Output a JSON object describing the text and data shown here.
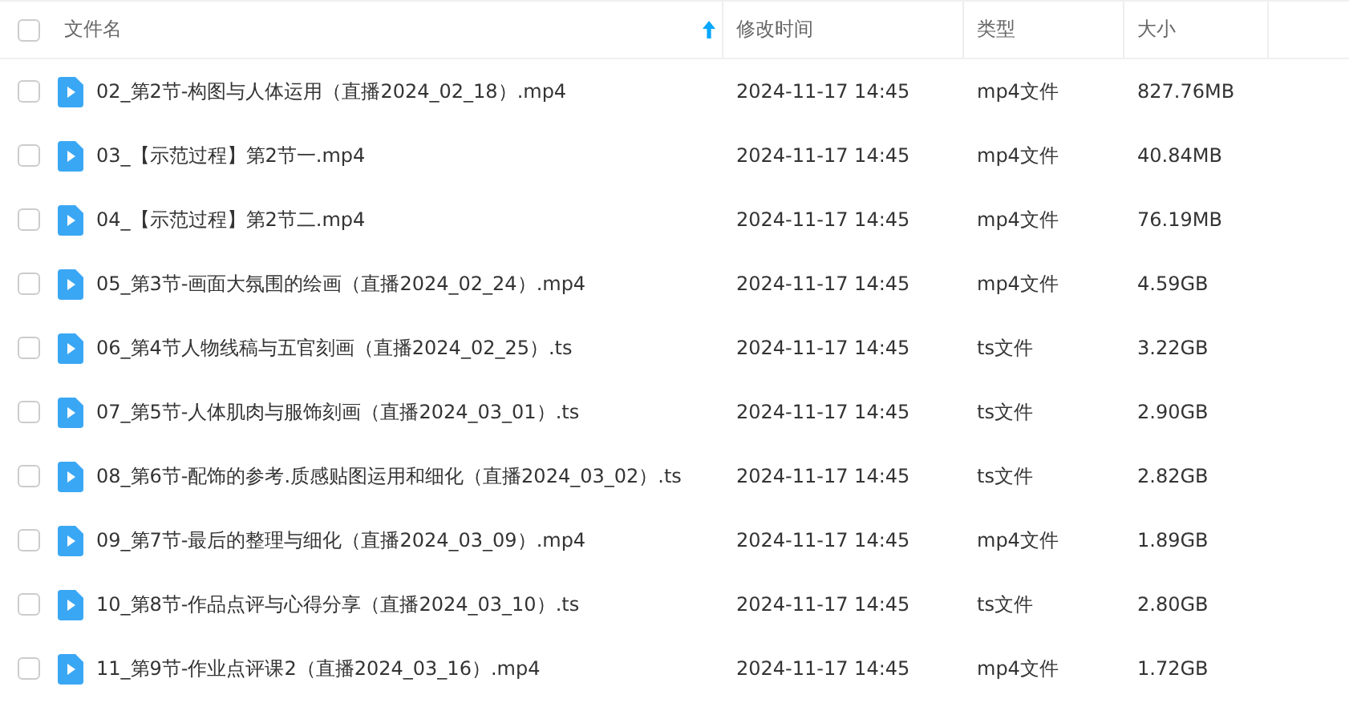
{
  "table": {
    "select_all": {
      "checked": false
    },
    "columns": [
      {
        "label": "文件名",
        "sorted": true
      },
      {
        "label": "修改时间",
        "sorted": false
      },
      {
        "label": "类型",
        "sorted": false
      },
      {
        "label": "大小",
        "sorted": false
      }
    ],
    "rows": [
      {
        "checked": false,
        "name": "02_第2节-构图与人体运用（直播2024_02_18）.mp4",
        "modified": "2024-11-17 14:45",
        "type": "mp4文件",
        "size": "827.76MB"
      },
      {
        "checked": false,
        "name": "03_【示范过程】第2节一.mp4",
        "modified": "2024-11-17 14:45",
        "type": "mp4文件",
        "size": "40.84MB"
      },
      {
        "checked": false,
        "name": "04_【示范过程】第2节二.mp4",
        "modified": "2024-11-17 14:45",
        "type": "mp4文件",
        "size": "76.19MB"
      },
      {
        "checked": false,
        "name": "05_第3节-画面大氛围的绘画（直播2024_02_24）.mp4",
        "modified": "2024-11-17 14:45",
        "type": "mp4文件",
        "size": "4.59GB"
      },
      {
        "checked": false,
        "name": "06_第4节人物线稿与五官刻画（直播2024_02_25）.ts",
        "modified": "2024-11-17 14:45",
        "type": "ts文件",
        "size": "3.22GB"
      },
      {
        "checked": false,
        "name": "07_第5节-人体肌肉与服饰刻画（直播2024_03_01）.ts",
        "modified": "2024-11-17 14:45",
        "type": "ts文件",
        "size": "2.90GB"
      },
      {
        "checked": false,
        "name": "08_第6节-配饰的参考.质感贴图运用和细化（直播2024_03_02）.ts",
        "modified": "2024-11-17 14:45",
        "type": "ts文件",
        "size": "2.82GB"
      },
      {
        "checked": false,
        "name": "09_第7节-最后的整理与细化（直播2024_03_09）.mp4",
        "modified": "2024-11-17 14:45",
        "type": "mp4文件",
        "size": "1.89GB"
      },
      {
        "checked": false,
        "name": "10_第8节-作品点评与心得分享（直播2024_03_10）.ts",
        "modified": "2024-11-17 14:45",
        "type": "ts文件",
        "size": "2.80GB"
      },
      {
        "checked": false,
        "name": "11_第9节-作业点评课2（直播2024_03_16）.mp4",
        "modified": "2024-11-17 14:45",
        "type": "mp4文件",
        "size": "1.72GB"
      }
    ]
  }
}
